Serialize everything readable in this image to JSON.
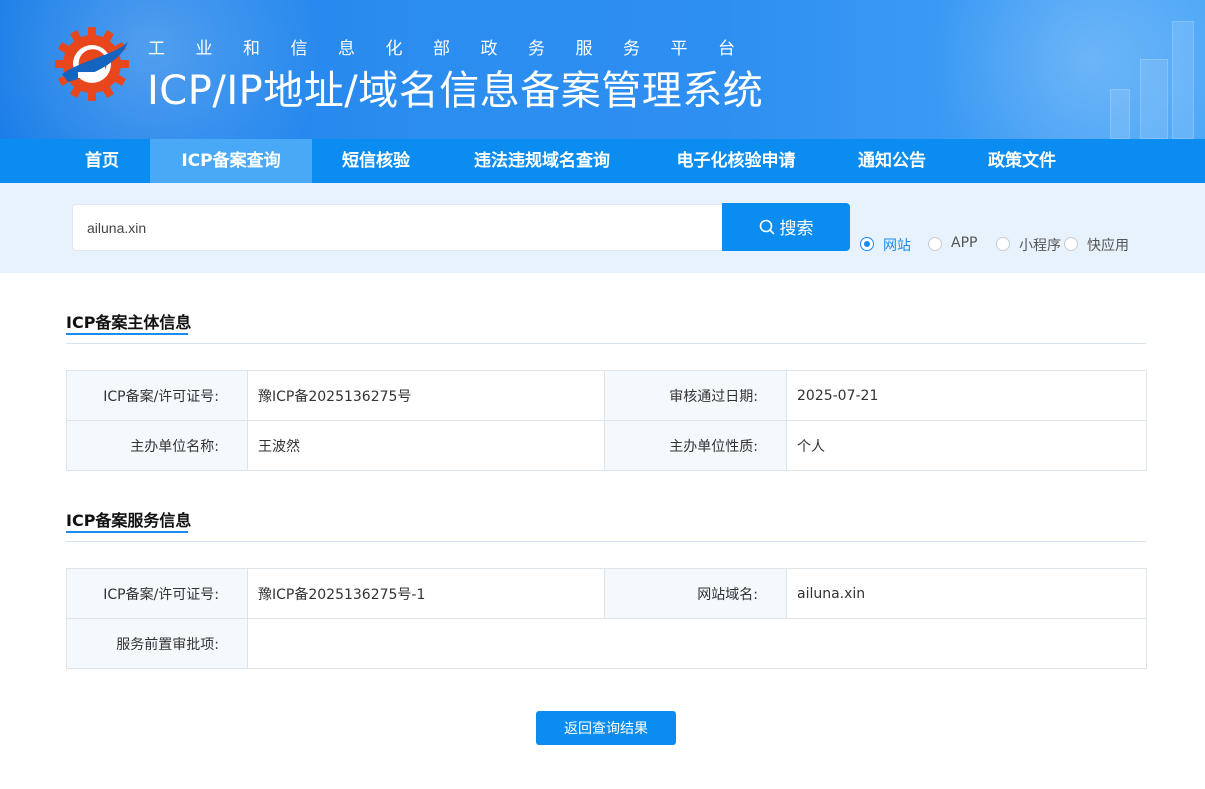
{
  "header": {
    "subtitle": "工业和信息化部政务服务平台",
    "title": "ICP/IP地址/域名信息备案管理系统"
  },
  "nav": {
    "items": [
      {
        "label": "首页"
      },
      {
        "label": "ICP备案查询"
      },
      {
        "label": "短信核验"
      },
      {
        "label": "违法违规域名查询"
      },
      {
        "label": "电子化核验申请"
      },
      {
        "label": "通知公告"
      },
      {
        "label": "政策文件"
      }
    ],
    "active": "ICP备案查询"
  },
  "search": {
    "value": "ailuna.xin",
    "button_label": "搜索",
    "types": [
      {
        "label": "网站",
        "checked": true
      },
      {
        "label": "APP",
        "checked": false
      },
      {
        "label": "小程序",
        "checked": false
      },
      {
        "label": "快应用",
        "checked": false
      }
    ]
  },
  "subject_info": {
    "title": "ICP备案主体信息",
    "license_label": "ICP备案/许可证号:",
    "license_value": "豫ICP备2025136275号",
    "approve_date_label": "审核通过日期:",
    "approve_date_value": "2025-07-21",
    "org_name_label": "主办单位名称:",
    "org_name_value": "王波然",
    "org_type_label": "主办单位性质:",
    "org_type_value": "个人"
  },
  "service_info": {
    "title": "ICP备案服务信息",
    "license_label": "ICP备案/许可证号:",
    "license_value": "豫ICP备2025136275号-1",
    "domain_label": "网站域名:",
    "domain_value": "ailuna.xin",
    "pre_approval_label": "服务前置审批项:",
    "pre_approval_value": ""
  },
  "back_button_label": "返回查询结果",
  "colors": {
    "primary": "#0b8cf0",
    "nav_active": "#4aa9f6",
    "search_band": "#e7f2fd"
  }
}
